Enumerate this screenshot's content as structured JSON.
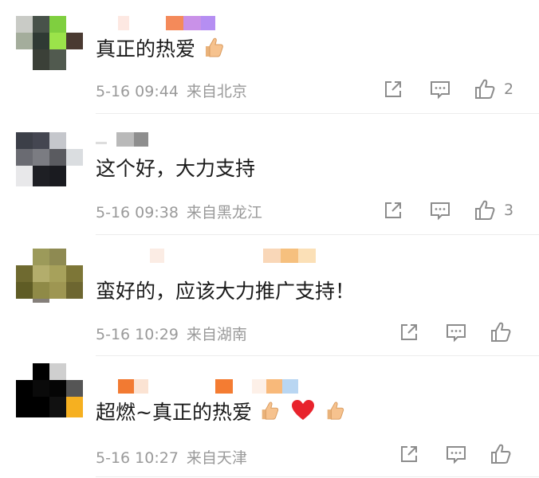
{
  "comments": [
    {
      "content": "真正的热爱",
      "date": "5-16 09:44",
      "location": "来自北京",
      "like_count": "2",
      "content_emojis": [
        "thumbs-up"
      ]
    },
    {
      "content": "这个好，大力支持",
      "date": "5-16 09:38",
      "location": "来自黑龙江",
      "like_count": "3",
      "content_emojis": []
    },
    {
      "content": "蛮好的，应该大力推广支持！",
      "date": "5-16 10:29",
      "location": "来自湖南",
      "like_count": "",
      "content_emojis": []
    },
    {
      "content": "超燃~真正的热爱",
      "date": "5-16 10:27",
      "location": "来自天津",
      "like_count": "",
      "content_emojis": [
        "thumbs-up",
        "red-heart",
        "thumbs-up"
      ]
    }
  ],
  "icons": {
    "share": "share-icon",
    "comment": "comment-icon",
    "like": "thumbs-up-icon"
  },
  "colors": {
    "meta_text": "#9a9a9a",
    "icon": "#8c8c8c",
    "divider": "#ececec"
  }
}
